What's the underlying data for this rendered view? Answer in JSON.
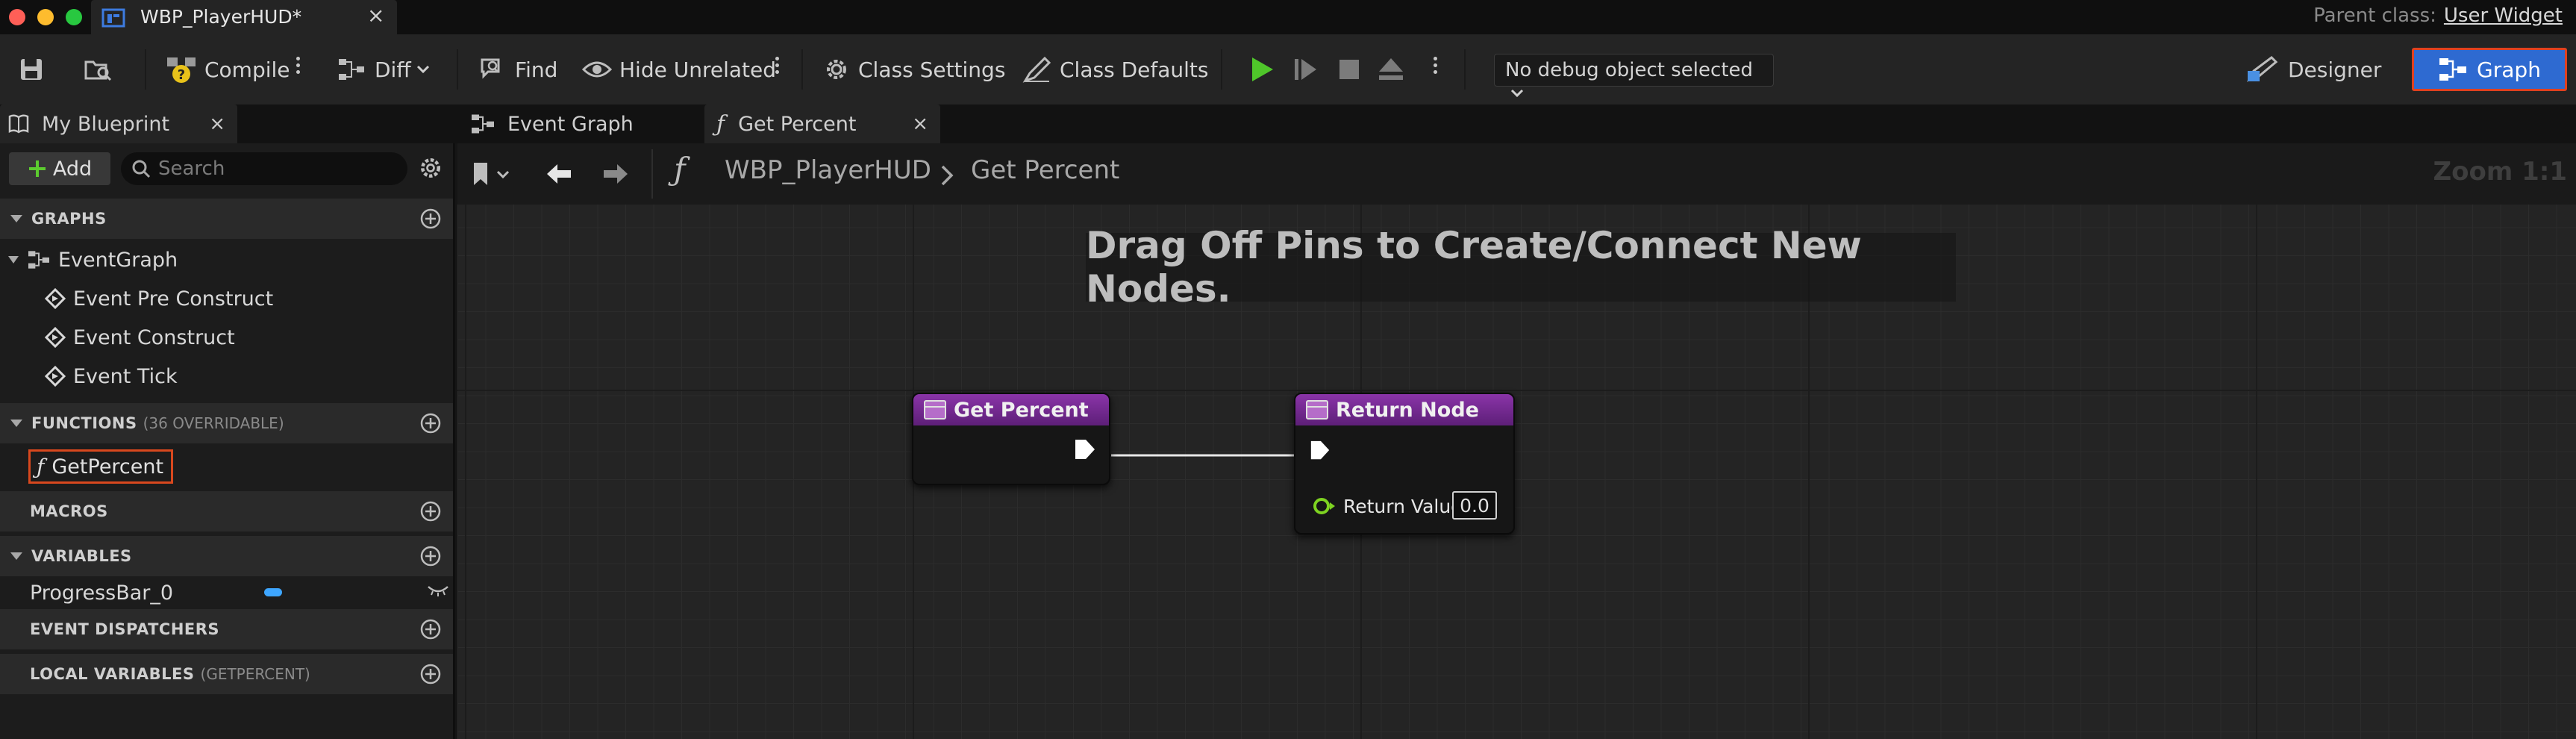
{
  "window": {
    "doc_tab_title": "WBP_PlayerHUD*",
    "parent_class_label": "Parent class:",
    "parent_class_value": "User Widget"
  },
  "toolbar": {
    "compile": "Compile",
    "diff": "Diff",
    "find": "Find",
    "hide_unrelated": "Hide Unrelated",
    "class_settings": "Class Settings",
    "class_defaults": "Class Defaults",
    "debug_object": "No debug object selected",
    "designer": "Designer",
    "graph": "Graph"
  },
  "tabs": {
    "my_blueprint": "My Blueprint",
    "event_graph": "Event Graph",
    "get_percent": "Get Percent"
  },
  "left_panel": {
    "add_label": "Add",
    "search_placeholder": "Search",
    "graphs_label": "GRAPHS",
    "event_graph": "EventGraph",
    "events": [
      "Event Pre Construct",
      "Event Construct",
      "Event Tick"
    ],
    "functions_label": "FUNCTIONS",
    "functions_sub": "(36 OVERRIDABLE)",
    "function_item": "GetPercent",
    "macros_label": "MACROS",
    "variables_label": "VARIABLES",
    "variable_item": "ProgressBar_0",
    "dispatchers_label": "EVENT DISPATCHERS",
    "local_vars_label": "LOCAL VARIABLES",
    "local_vars_sub": "(GETPERCENT)"
  },
  "graph": {
    "breadcrumb_root": "WBP_PlayerHUD",
    "breadcrumb_current": "Get Percent",
    "zoom": "Zoom 1:1",
    "hint": "Drag Off Pins to Create/Connect New Nodes.",
    "entry_node_title": "Get Percent",
    "return_node_title": "Return Node",
    "return_value_label": "Return Value",
    "return_value": "0.0"
  },
  "colors": {
    "accent": "#2e6ad1",
    "highlight": "#d8481e",
    "node_header": "#8a34a8",
    "float_pin": "#7ed321"
  }
}
